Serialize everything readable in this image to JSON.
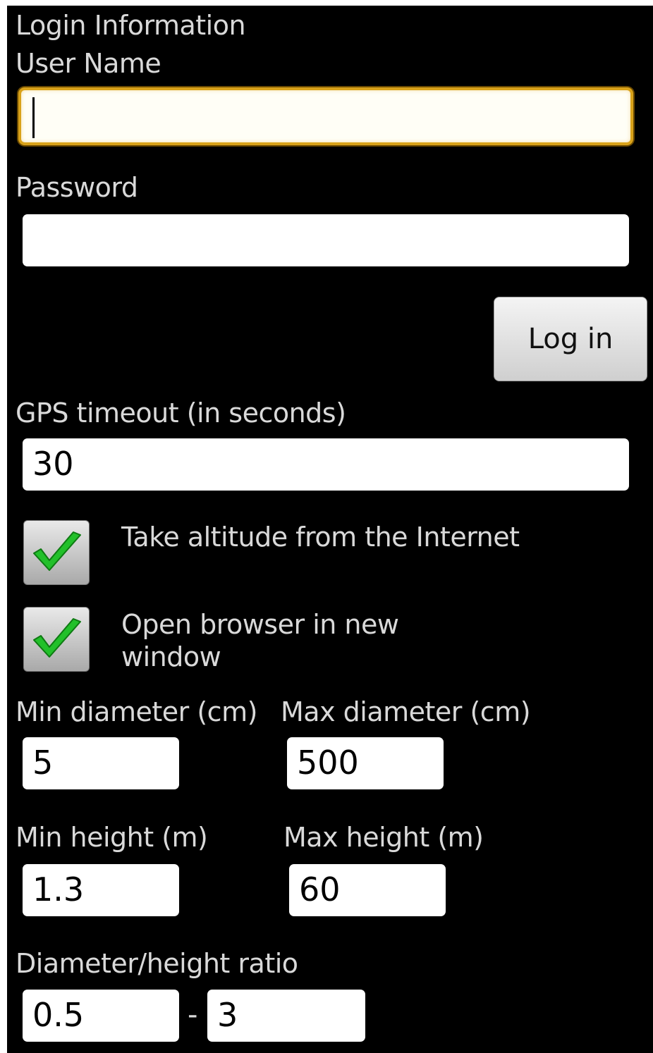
{
  "login": {
    "section_title": "Login Information",
    "username_label": "User Name",
    "username_value": "",
    "password_label": "Password",
    "password_value": "",
    "login_button": "Log in"
  },
  "gps": {
    "timeout_label": "GPS timeout (in seconds)",
    "timeout_value": "30"
  },
  "options": {
    "altitude_label": "Take altitude from the Internet",
    "altitude_checked": true,
    "browser_label_line1": "Open browser in new",
    "browser_label_line2": "window",
    "browser_checked": true
  },
  "diameter": {
    "min_label": "Min diameter (cm)",
    "min_value": "5",
    "max_label": "Max diameter (cm)",
    "max_value": "500"
  },
  "height": {
    "min_label": "Min height (m)",
    "min_value": "1.3",
    "max_label": "Max height (m)",
    "max_value": "60"
  },
  "ratio": {
    "label": "Diameter/height ratio",
    "min_value": "0.5",
    "separator": "-",
    "max_value": "3"
  },
  "colors": {
    "background": "#000000",
    "label_text": "#d9d9d9",
    "focus_border": "#d9a21a",
    "checkmark": "#22c02a"
  }
}
